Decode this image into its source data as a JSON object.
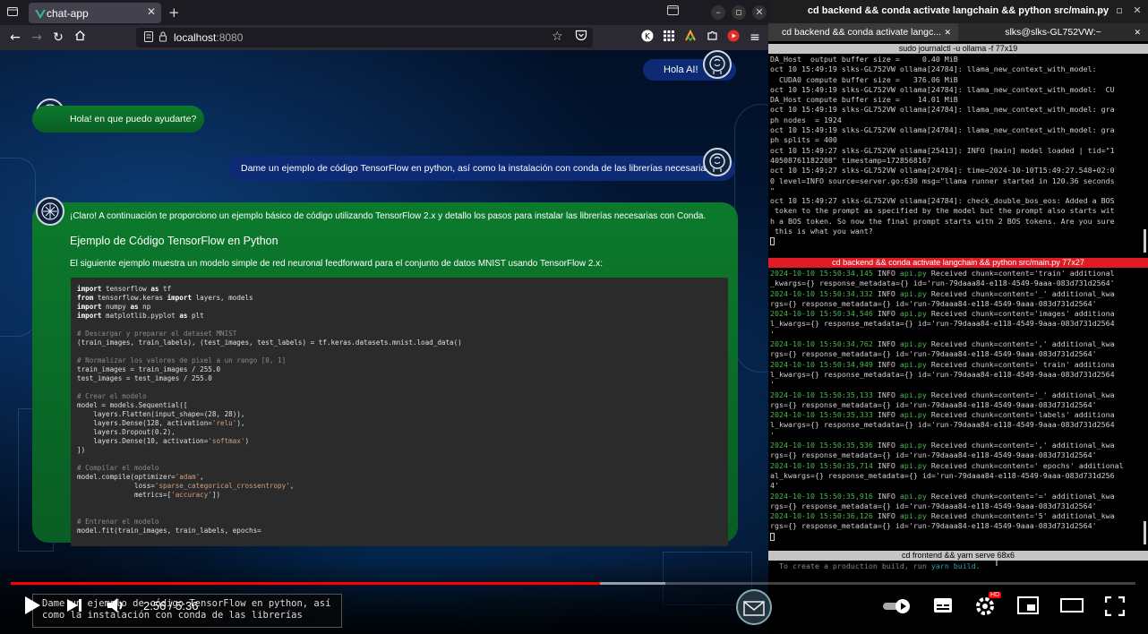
{
  "browser": {
    "tab_title": "chat-app",
    "url_host": "localhost",
    "url_port": ":8080"
  },
  "chat": {
    "msg1_user": "Hola AI!",
    "msg2_ai": "Hola! en que puedo ayudarte?",
    "msg3_user": "Dame un ejemplo de código TensorFlow en python, así como la instalación con conda de las librerías necesarias.",
    "msg4_intro": "¡Claro! A continuación te proporciono un ejemplo básico de código utilizando TensorFlow 2.x y detallo los pasos para instalar las librerías necesarias con Conda.",
    "msg4_heading": "Ejemplo de Código TensorFlow en Python",
    "msg4_para": "El siguiente ejemplo muestra un modelo simple de red neuronal feedforward para el conjunto de datos MNIST usando TensorFlow 2.x:",
    "code_lines": [
      "import tensorflow as tf",
      "from tensorflow.keras import layers, models",
      "import numpy as np",
      "import matplotlib.pyplot as plt",
      "",
      "# Descargar y preparar el dataset MNIST",
      "(train_images, train_labels), (test_images, test_labels) = tf.keras.datasets.mnist.load_data()",
      "",
      "# Normalizar los valores de pixel a un rango [0, 1]",
      "train_images = train_images / 255.0",
      "test_images = test_images / 255.0",
      "",
      "# Crear el modelo",
      "model = models.Sequential([",
      "    layers.Flatten(input_shape=(28, 28)),",
      "    layers.Dense(128, activation='relu'),",
      "    layers.Dropout(0.2),",
      "    layers.Dense(10, activation='softmax')",
      "])",
      "",
      "# Compilar el modelo",
      "model.compile(optimizer='adam',",
      "              loss='sparse_categorical_crossentropy',",
      "              metrics=['accuracy'])",
      "",
      "",
      "# Entrenar el modelo",
      "model.fit(train_images, train_labels, epochs="
    ]
  },
  "video": {
    "subtitle_line1": "Dame un ejemplo de código TensorFlow en python, así",
    "subtitle_line2": "como la instalación con conda de las librerías",
    "time": "2:56 / 5:36",
    "played_fraction": 0.524,
    "buffered_fraction": 0.582,
    "hd_badge": "HD"
  },
  "terminal": {
    "window_title": "cd backend && conda activate langchain && python src/main.py",
    "tab1": "cd backend && conda activate langc...",
    "tab2": "slks@slks-GL752VW:~",
    "pane1_title": "sudo journalctl -u ollama -f 77x19",
    "pane1_lines": [
      "DA_Host  output buffer size =     0.40 MiB",
      "oct 10 15:49:19 slks-GL752VW ollama[24784]: llama_new_context_with_model:",
      "  CUDA0 compute buffer size =   376.06 MiB",
      "oct 10 15:49:19 slks-GL752VW ollama[24784]: llama_new_context_with_model:  CU",
      "DA_Host compute buffer size =    14.01 MiB",
      "oct 10 15:49:19 slks-GL752VW ollama[24784]: llama_new_context_with_model: gra",
      "ph nodes  = 1924",
      "oct 10 15:49:19 slks-GL752VW ollama[24784]: llama_new_context_with_model: gra",
      "ph splits = 400",
      "oct 10 15:49:27 slks-GL752VW ollama[25413]: INFO [main] model loaded | tid=\"1",
      "40508761182208\" timestamp=1728568167",
      "oct 10 15:49:27 slks-GL752VW ollama[24784]: time=2024-10-10T15:49:27.548+02:0",
      "0 level=INFO source=server.go:630 msg=\"llama runner started in 120.36 seconds",
      "\"",
      "oct 10 15:49:27 slks-GL752VW ollama[24784]: check_double_bos_eos: Added a BOS",
      " token to the prompt as specified by the model but the prompt also starts wit",
      "h a BOS token. So now the final prompt starts with 2 BOS tokens. Are you sure",
      " this is what you want?"
    ],
    "pane2_title": "cd backend && conda activate langchain && python src/main.py 77x27",
    "pane2_entries": [
      {
        "ts": "2024-10-10 15:50:34,145",
        "msg": " INFO api.py Received chunk=content='train' additional",
        "cont": "_kwargs={} response_metadata={} id='run-79daaa84-e118-4549-9aaa-083d731d2564'"
      },
      {
        "ts": "2024-10-10 15:50:34,332",
        "msg": " INFO api.py Received chunk=content='_' additional_kwa",
        "cont": "rgs={} response_metadata={} id='run-79daaa84-e118-4549-9aaa-083d731d2564'"
      },
      {
        "ts": "2024-10-10 15:50:34,546",
        "msg": " INFO api.py Received chunk=content='images' additiona",
        "cont": "l_kwargs={} response_metadata={} id='run-79daaa84-e118-4549-9aaa-083d731d2564"
      },
      {
        "ts": "",
        "msg": "",
        "cont": "'"
      },
      {
        "ts": "2024-10-10 15:50:34,762",
        "msg": " INFO api.py Received chunk=content=',' additional_kwa",
        "cont": "rgs={} response_metadata={} id='run-79daaa84-e118-4549-9aaa-083d731d2564'"
      },
      {
        "ts": "2024-10-10 15:50:34,949",
        "msg": " INFO api.py Received chunk=content=' train' additiona",
        "cont": "l_kwargs={} response_metadata={} id='run-79daaa84-e118-4549-9aaa-083d731d2564"
      },
      {
        "ts": "",
        "msg": "",
        "cont": "'"
      },
      {
        "ts": "2024-10-10 15:50:35,133",
        "msg": " INFO api.py Received chunk=content='_' additional_kwa",
        "cont": "rgs={} response_metadata={} id='run-79daaa84-e118-4549-9aaa-083d731d2564'"
      },
      {
        "ts": "2024-10-10 15:50:35,333",
        "msg": " INFO api.py Received chunk=content='labels' additiona",
        "cont": "l_kwargs={} response_metadata={} id='run-79daaa84-e118-4549-9aaa-083d731d2564"
      },
      {
        "ts": "",
        "msg": "",
        "cont": "'"
      },
      {
        "ts": "2024-10-10 15:50:35,536",
        "msg": " INFO api.py Received chunk=content=',' additional_kwa",
        "cont": "rgs={} response_metadata={} id='run-79daaa84-e118-4549-9aaa-083d731d2564'"
      },
      {
        "ts": "2024-10-10 15:50:35,714",
        "msg": " INFO api.py Received chunk=content=' epochs' additional",
        "cont": "al_kwargs={} response_metadata={} id='run-79daaa84-e118-4549-9aaa-083d731d256"
      },
      {
        "ts": "",
        "msg": "",
        "cont": "4'"
      },
      {
        "ts": "2024-10-10 15:50:35,916",
        "msg": " INFO api.py Received chunk=content='=' additional_kwa",
        "cont": "rgs={} response_metadata={} id='run-79daaa84-e118-4549-9aaa-083d731d2564'"
      },
      {
        "ts": "2024-10-10 15:50:36,126",
        "msg": " INFO api.py Received chunk=content='5' additional_kwa",
        "cont": "rgs={} response_metadata={} id='run-79daaa84-e118-4549-9aaa-083d731d2564'"
      }
    ],
    "pane3_title": "cd frontend && yarn serve 68x6",
    "pane3_prefix": "  To create a production build, run ",
    "pane3_cmd": "yarn build",
    "pane3_suffix": "."
  },
  "colors": {
    "accent_red": "#ff0000",
    "ai_bubble": "#0b7a2c",
    "user_bubble": "#0d2a75",
    "log_timestamp": "#4cb74c"
  }
}
